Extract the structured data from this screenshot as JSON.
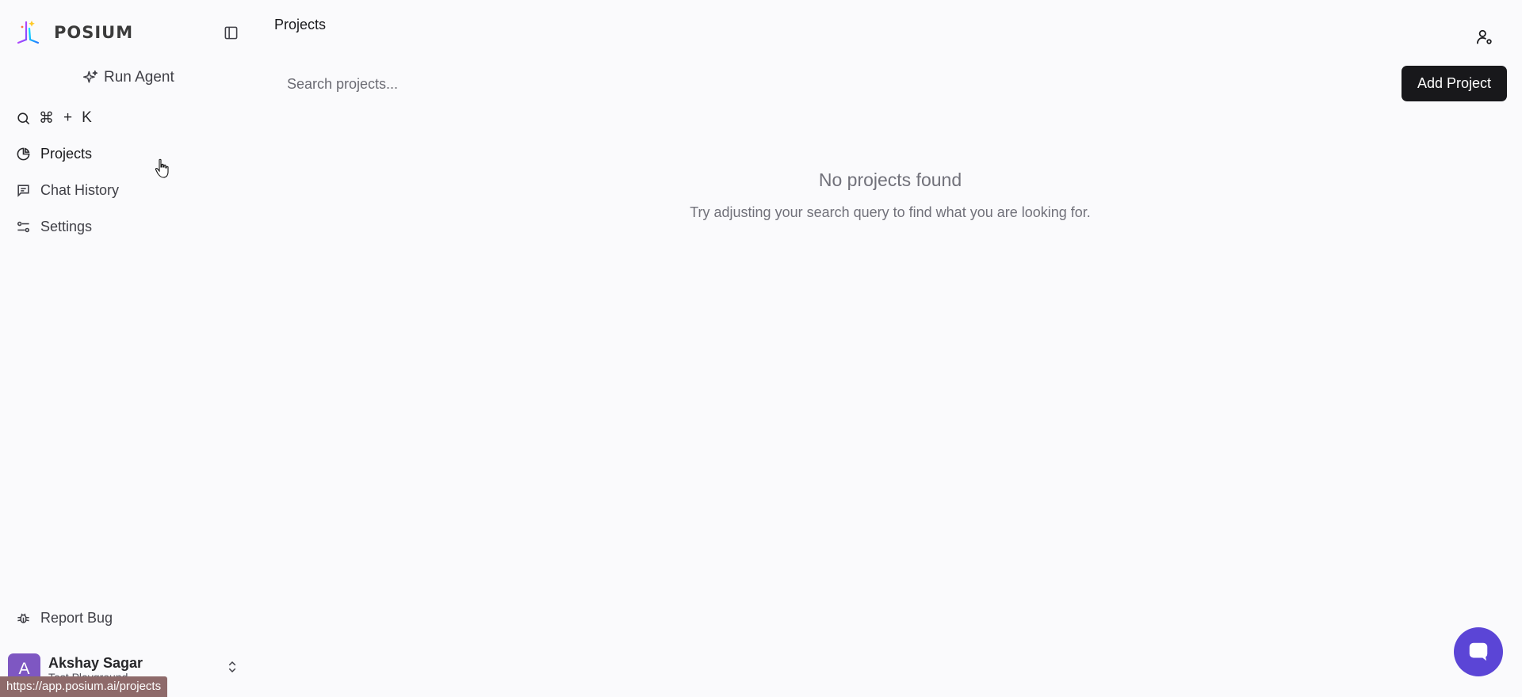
{
  "brand": {
    "name": "POSIUM"
  },
  "sidebar": {
    "run_agent": "Run Agent",
    "shortcut": {
      "cmd": "⌘",
      "plus": "+",
      "key": "K"
    },
    "items": [
      {
        "label": "Projects",
        "icon": "pie-chart-icon",
        "active": true
      },
      {
        "label": "Chat History",
        "icon": "message-icon"
      },
      {
        "label": "Settings",
        "icon": "sliders-icon"
      }
    ],
    "report_bug": "Report Bug",
    "user": {
      "initial": "A",
      "name": "Akshay Sagar",
      "org": "Test Playground"
    }
  },
  "header": {
    "title": "Projects"
  },
  "search": {
    "placeholder": "Search projects...",
    "value": ""
  },
  "actions": {
    "add_project": "Add Project"
  },
  "empty_state": {
    "title": "No projects found",
    "subtitle": "Try adjusting your search query to find what you are looking for."
  },
  "status_bar": {
    "url": "https://app.posium.ai/projects"
  },
  "colors": {
    "accent": "#5b45d6",
    "avatar": "#7e57c2",
    "button": "#18181b"
  }
}
